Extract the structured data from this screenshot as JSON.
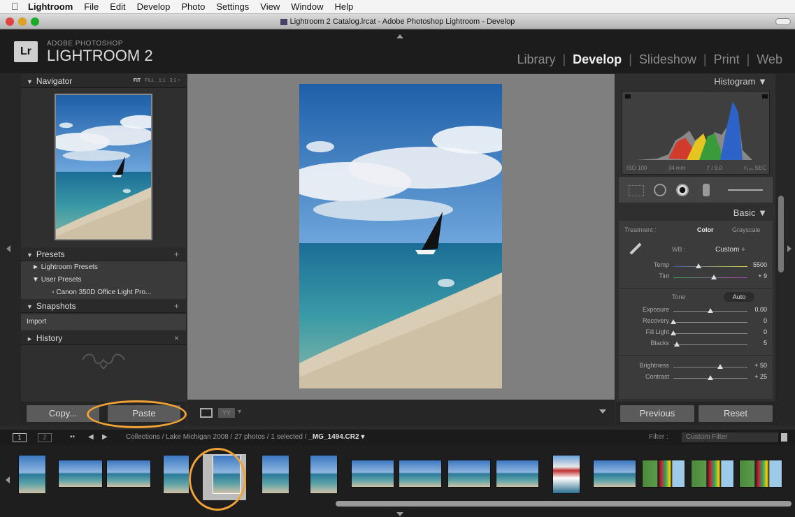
{
  "menubar": {
    "app": "Lightroom",
    "items": [
      "File",
      "Edit",
      "Develop",
      "Photo",
      "Settings",
      "View",
      "Window",
      "Help"
    ]
  },
  "window": {
    "title": "Lightroom 2 Catalog.lrcat - Adobe Photoshop Lightroom - Develop"
  },
  "brand": {
    "badge": "Lr",
    "line1": "ADOBE PHOTOSHOP",
    "line2": "LIGHTROOM 2"
  },
  "modules": {
    "library": "Library",
    "develop": "Develop",
    "slideshow": "Slideshow",
    "print": "Print",
    "web": "Web",
    "separator": "|"
  },
  "left": {
    "navigator": {
      "title": "Navigator",
      "fit": "FIT",
      "fill": "FILL",
      "one": "1:1",
      "ratio": "3:1 ÷"
    },
    "presets": {
      "title": "Presets",
      "lr_presets": "Lightroom Presets",
      "user_presets": "User Presets",
      "item": "Canon 350D Office Light Pro..."
    },
    "snapshots": {
      "title": "Snapshots",
      "item": "Import"
    },
    "history": {
      "title": "History",
      "clear": "×"
    },
    "copy": "Copy...",
    "paste": "Paste"
  },
  "right": {
    "histogram": {
      "title": "Histogram",
      "iso": "ISO 100",
      "focal": "34 mm",
      "aperture": "ƒ / 9.0",
      "shutter": "¹⁄₄₀₀ SEC"
    },
    "basic": {
      "title": "Basic",
      "treatment_label": "Treatment :",
      "color": "Color",
      "grayscale": "Grayscale",
      "wb_label": "WB :",
      "wb_value": "Custom ÷",
      "temp_label": "Temp",
      "temp_value": "5500",
      "temp_pos": 0.34,
      "tint_label": "Tint",
      "tint_value": "+ 9",
      "tint_pos": 0.55,
      "tone_label": "Tone",
      "auto": "Auto",
      "exposure_label": "Exposure",
      "exposure_value": "0.00",
      "exposure_pos": 0.5,
      "recovery_label": "Recovery",
      "recovery_value": "0",
      "recovery_pos": 0.0,
      "filllight_label": "Fill Light",
      "filllight_value": "0",
      "filllight_pos": 0.0,
      "blacks_label": "Blacks",
      "blacks_value": "5",
      "blacks_pos": 0.05,
      "brightness_label": "Brightness",
      "brightness_value": "+ 50",
      "brightness_pos": 0.63,
      "contrast_label": "Contrast",
      "contrast_value": "+ 25",
      "contrast_pos": 0.5
    },
    "previous": "Previous",
    "reset": "Reset"
  },
  "filmstrip": {
    "page1": "1",
    "page2": "2",
    "path": "Collections / Lake Michigan 2008 / 27 photos / 1 selected / ",
    "filename": "_MG_1494.CR2 ▾",
    "filter_label": "Filter :",
    "filter_value": "Custom Filter"
  },
  "colors": {
    "highlight": "#f0a236"
  }
}
